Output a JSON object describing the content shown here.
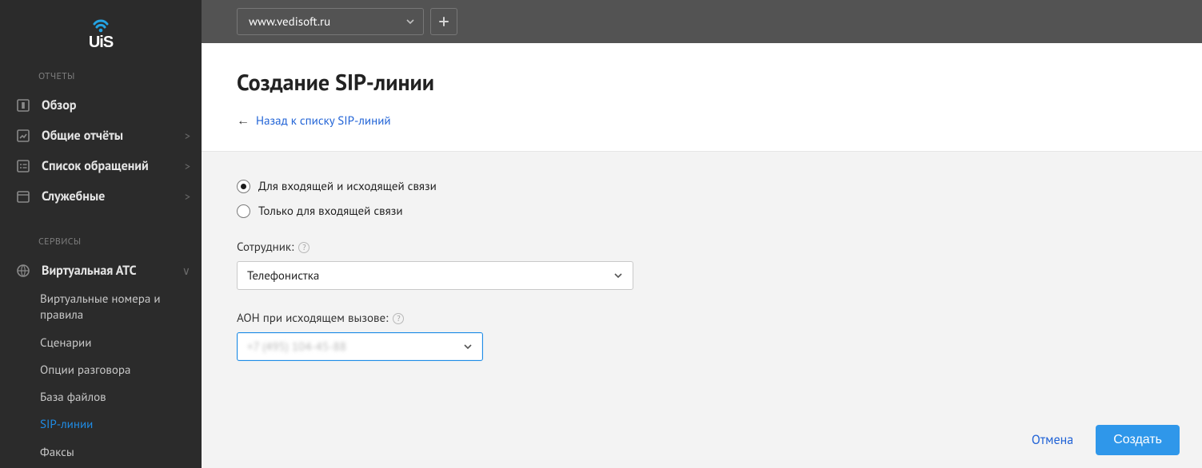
{
  "sidebar": {
    "section_reports": "ОТЧЕТЫ",
    "section_services": "СЕРВИСЫ",
    "reports": [
      {
        "label": "Обзор",
        "expandable": false
      },
      {
        "label": "Общие отчёты",
        "expandable": true
      },
      {
        "label": "Список обращений",
        "expandable": true
      },
      {
        "label": "Служебные",
        "expandable": true
      }
    ],
    "services": {
      "vatc_label": "Виртуальная АТС",
      "sub": [
        "Виртуальные номера и правила",
        "Сценарии",
        "Опции разговора",
        "База файлов",
        "SIP-линии",
        "Факсы"
      ],
      "active_sub_index": 4
    }
  },
  "topbar": {
    "site_value": "www.vedisoft.ru"
  },
  "page": {
    "title": "Создание SIP-линии",
    "back_text": "Назад к списку SIP-линий"
  },
  "form": {
    "radio_both": "Для входящей и исходящей связи",
    "radio_in_only": "Только для входящей связи",
    "employee_label": "Сотрудник:",
    "employee_value": "Телефонистка",
    "aon_label": "АОН при исходящем вызове:",
    "aon_value": "+7 (495) 104-45-88"
  },
  "footer": {
    "cancel": "Отмена",
    "submit": "Создать"
  }
}
